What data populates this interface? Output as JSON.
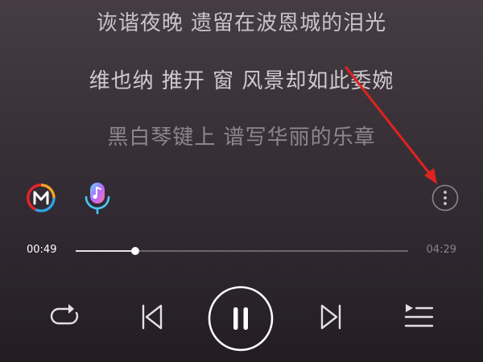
{
  "lyrics": {
    "lines": [
      "诙谐夜晚 遗留在波恩城的泪光",
      "维也纳 推开 窗 风景却如此委婉",
      "黑白琴键上 谱写华丽的乐章"
    ]
  },
  "tools": {
    "icons": [
      "m-logo-icon",
      "music-mic-icon",
      "more-vertical-icon"
    ]
  },
  "progress": {
    "current_time": "00:49",
    "total_time": "04:29",
    "fraction": 0.18
  },
  "controls": {
    "icons": [
      "repeat-icon",
      "previous-icon",
      "pause-icon",
      "next-icon",
      "playlist-icon"
    ]
  },
  "colors": {
    "accent_red": "#e8232a",
    "accent_orange": "#f5a623",
    "accent_blue": "#2fa3e6",
    "arrow_red": "#e0231f"
  }
}
